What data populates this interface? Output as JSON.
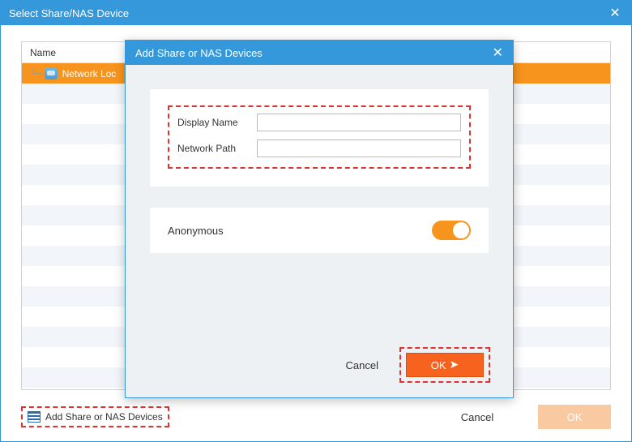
{
  "mainWindow": {
    "title": "Select Share/NAS Device",
    "table": {
      "header": "Name",
      "selectedItem": "Network Loc"
    },
    "footer": {
      "addLink": "Add Share or NAS Devices",
      "cancel": "Cancel",
      "ok": "OK"
    }
  },
  "modal": {
    "title": "Add Share or NAS Devices",
    "fields": {
      "displayNameLabel": "Display Name",
      "displayNameValue": "",
      "networkPathLabel": "Network Path",
      "networkPathValue": ""
    },
    "anonymousLabel": "Anonymous",
    "anonymousOn": true,
    "cancel": "Cancel",
    "ok": "OK"
  }
}
